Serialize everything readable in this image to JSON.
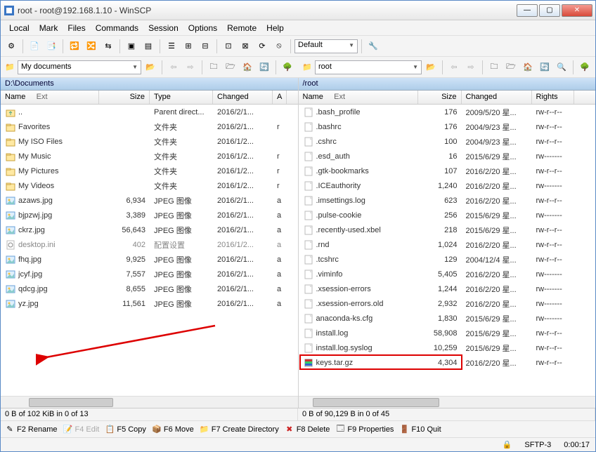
{
  "title": "root - root@192.168.1.10 - WinSCP",
  "menu": [
    "Local",
    "Mark",
    "Files",
    "Commands",
    "Session",
    "Options",
    "Remote",
    "Help"
  ],
  "session_combo": "Default",
  "left": {
    "combo": "My documents",
    "path": "D:\\Documents",
    "cols": [
      "Name",
      "Ext",
      "Size",
      "Type",
      "Changed",
      "A"
    ],
    "rows": [
      {
        "icon": "folder-up",
        "name": "..",
        "size": "",
        "type": "Parent direct...",
        "changed": "2016/2/1...",
        "a": ""
      },
      {
        "icon": "folder",
        "name": "Favorites",
        "size": "",
        "type": "文件夹",
        "changed": "2016/2/1...",
        "a": "r"
      },
      {
        "icon": "folder",
        "name": "My ISO Files",
        "size": "",
        "type": "文件夹",
        "changed": "2016/1/2...",
        "a": ""
      },
      {
        "icon": "folder",
        "name": "My Music",
        "size": "",
        "type": "文件夹",
        "changed": "2016/1/2...",
        "a": "r"
      },
      {
        "icon": "folder",
        "name": "My Pictures",
        "size": "",
        "type": "文件夹",
        "changed": "2016/1/2...",
        "a": "r"
      },
      {
        "icon": "folder",
        "name": "My Videos",
        "size": "",
        "type": "文件夹",
        "changed": "2016/1/2...",
        "a": "r"
      },
      {
        "icon": "image",
        "name": "azaws.jpg",
        "size": "6,934",
        "type": "JPEG 图像",
        "changed": "2016/2/1...",
        "a": "a"
      },
      {
        "icon": "image",
        "name": "bjpzwj.jpg",
        "size": "3,389",
        "type": "JPEG 图像",
        "changed": "2016/2/1...",
        "a": "a"
      },
      {
        "icon": "image",
        "name": "ckrz.jpg",
        "size": "56,643",
        "type": "JPEG 图像",
        "changed": "2016/2/1...",
        "a": "a"
      },
      {
        "icon": "ini",
        "name": "desktop.ini",
        "size": "402",
        "type": "配置设置",
        "changed": "2016/1/2...",
        "a": "a",
        "dim": true
      },
      {
        "icon": "image",
        "name": "fhq.jpg",
        "size": "9,925",
        "type": "JPEG 图像",
        "changed": "2016/2/1...",
        "a": "a"
      },
      {
        "icon": "image",
        "name": "jcyf.jpg",
        "size": "7,557",
        "type": "JPEG 图像",
        "changed": "2016/2/1...",
        "a": "a"
      },
      {
        "icon": "image",
        "name": "qdcg.jpg",
        "size": "8,655",
        "type": "JPEG 图像",
        "changed": "2016/2/1...",
        "a": "a"
      },
      {
        "icon": "image",
        "name": "yz.jpg",
        "size": "11,561",
        "type": "JPEG 图像",
        "changed": "2016/2/1...",
        "a": "a"
      }
    ],
    "status": "0 B of 102 KiB in 0 of 13"
  },
  "right": {
    "combo": "root",
    "path": "/root",
    "cols": [
      "Name",
      "Ext",
      "Size",
      "Changed",
      "Rights"
    ],
    "rows": [
      {
        "icon": "file",
        "name": ".bash_profile",
        "size": "176",
        "changed": "2009/5/20 星...",
        "rights": "rw-r--r--"
      },
      {
        "icon": "file",
        "name": ".bashrc",
        "size": "176",
        "changed": "2004/9/23 星...",
        "rights": "rw-r--r--"
      },
      {
        "icon": "file",
        "name": ".cshrc",
        "size": "100",
        "changed": "2004/9/23 星...",
        "rights": "rw-r--r--"
      },
      {
        "icon": "file",
        "name": ".esd_auth",
        "size": "16",
        "changed": "2015/6/29 星...",
        "rights": "rw-------"
      },
      {
        "icon": "file",
        "name": ".gtk-bookmarks",
        "size": "107",
        "changed": "2016/2/20 星...",
        "rights": "rw-r--r--"
      },
      {
        "icon": "file",
        "name": ".ICEauthority",
        "size": "1,240",
        "changed": "2016/2/20 星...",
        "rights": "rw-------"
      },
      {
        "icon": "file",
        "name": ".imsettings.log",
        "size": "623",
        "changed": "2016/2/20 星...",
        "rights": "rw-r--r--"
      },
      {
        "icon": "file",
        "name": ".pulse-cookie",
        "size": "256",
        "changed": "2015/6/29 星...",
        "rights": "rw-------"
      },
      {
        "icon": "file",
        "name": ".recently-used.xbel",
        "size": "218",
        "changed": "2015/6/29 星...",
        "rights": "rw-r--r--"
      },
      {
        "icon": "file",
        "name": ".rnd",
        "size": "1,024",
        "changed": "2016/2/20 星...",
        "rights": "rw-r--r--"
      },
      {
        "icon": "file",
        "name": ".tcshrc",
        "size": "129",
        "changed": "2004/12/4 星...",
        "rights": "rw-r--r--"
      },
      {
        "icon": "file",
        "name": ".viminfo",
        "size": "5,405",
        "changed": "2016/2/20 星...",
        "rights": "rw-------"
      },
      {
        "icon": "file",
        "name": ".xsession-errors",
        "size": "1,244",
        "changed": "2016/2/20 星...",
        "rights": "rw-------"
      },
      {
        "icon": "file",
        "name": ".xsession-errors.old",
        "size": "2,932",
        "changed": "2016/2/20 星...",
        "rights": "rw-------"
      },
      {
        "icon": "file",
        "name": "anaconda-ks.cfg",
        "size": "1,830",
        "changed": "2015/6/29 星...",
        "rights": "rw-------"
      },
      {
        "icon": "file",
        "name": "install.log",
        "size": "58,908",
        "changed": "2015/6/29 星...",
        "rights": "rw-r--r--"
      },
      {
        "icon": "file",
        "name": "install.log.syslog",
        "size": "10,259",
        "changed": "2015/6/29 星...",
        "rights": "rw-r--r--"
      },
      {
        "icon": "archive",
        "name": "keys.tar.gz",
        "size": "4,304",
        "changed": "2016/2/20 星...",
        "rights": "rw-r--r--",
        "highlight": true
      }
    ],
    "status": "0 B of 90,129 B in 0 of 45"
  },
  "fn": {
    "f2": "F2 Rename",
    "f4": "F4 Edit",
    "f5": "F5 Copy",
    "f6": "F6 Move",
    "f7": "F7 Create Directory",
    "f8": "F8 Delete",
    "f9": "F9 Properties",
    "f10": "F10 Quit"
  },
  "bottom": {
    "proto": "SFTP-3",
    "time": "0:00:17"
  }
}
